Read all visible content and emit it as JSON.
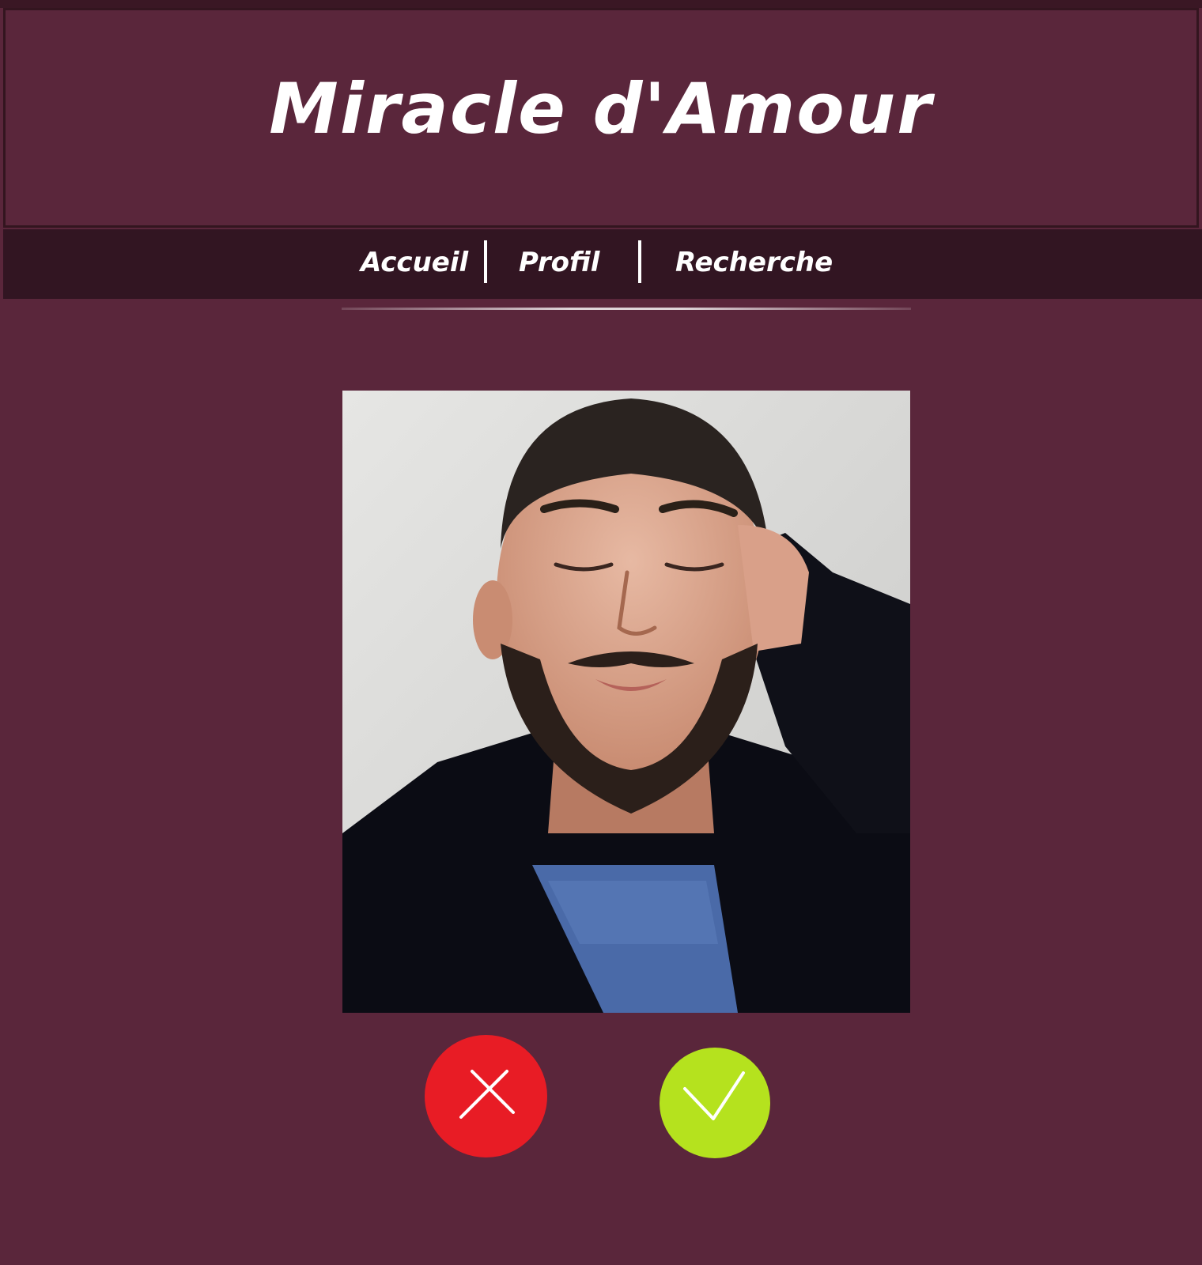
{
  "header": {
    "title": "Miracle d'Amour"
  },
  "nav": {
    "items": [
      {
        "label": "Accueil"
      },
      {
        "label": "Profil"
      },
      {
        "label": "Recherche"
      }
    ]
  },
  "profile": {
    "photo_icon": "person-photo"
  },
  "actions": {
    "reject_icon": "close-icon",
    "accept_icon": "check-icon",
    "reject_color": "#e81c25",
    "accept_color": "#b5e21e"
  },
  "colors": {
    "background": "#5a263b",
    "navbar": "#321522",
    "text": "#ffffff"
  }
}
